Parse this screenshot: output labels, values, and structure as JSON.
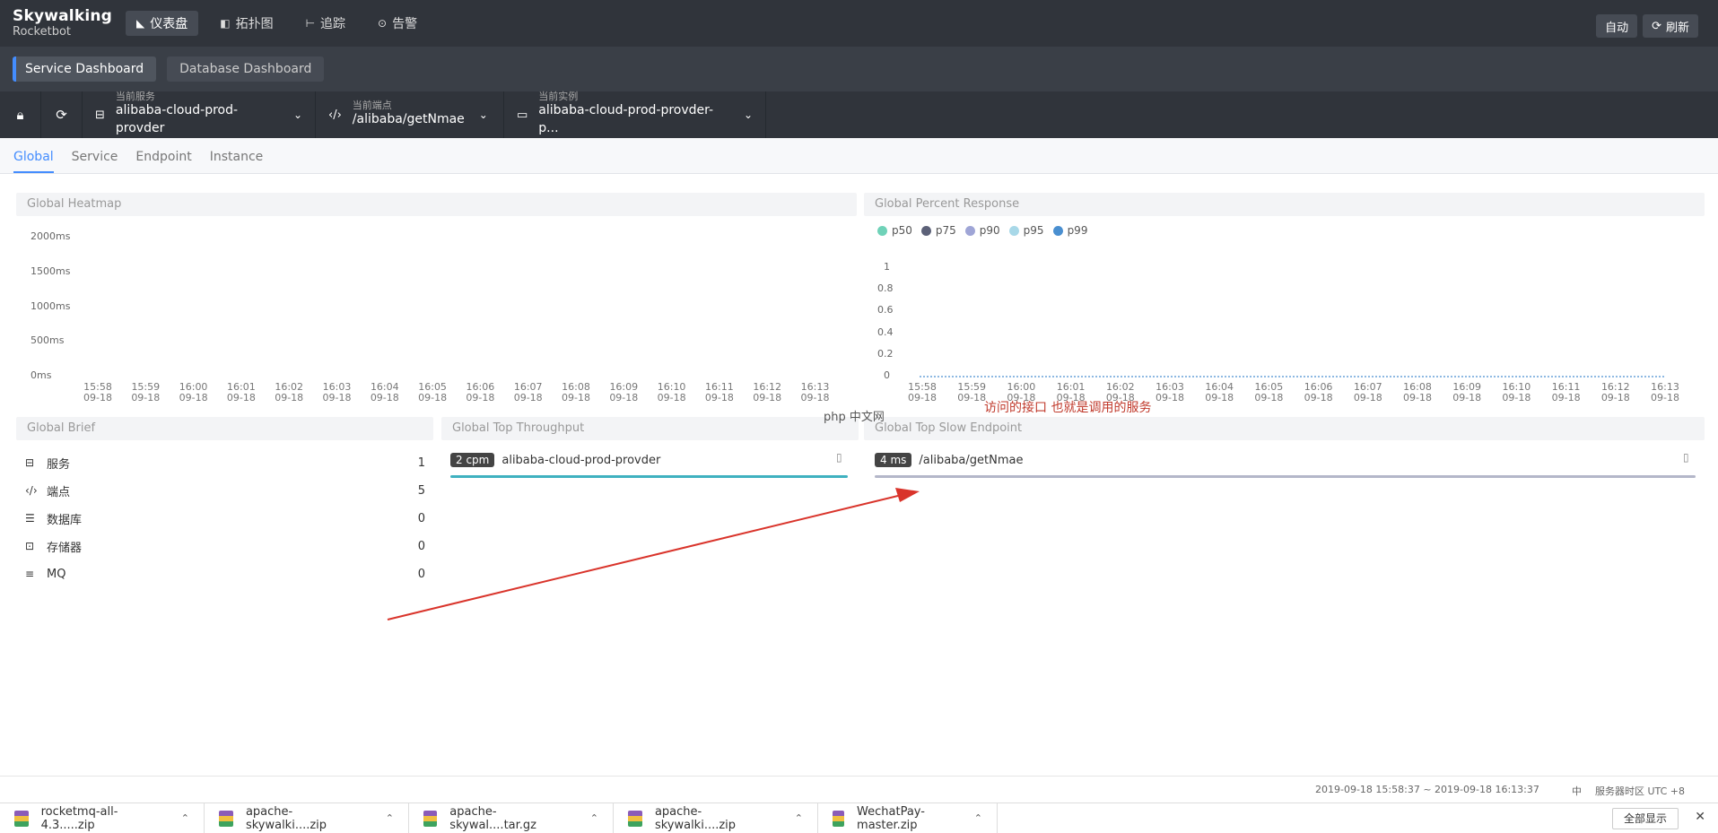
{
  "topbar": {
    "logo_line1": "Skywalking",
    "logo_line2": "Rocketbot",
    "nav": [
      {
        "icon": "dashboard-icon",
        "glyph": "◣",
        "label": "仪表盘",
        "active": true
      },
      {
        "icon": "topology-icon",
        "glyph": "◧",
        "label": "拓扑图",
        "active": false
      },
      {
        "icon": "trace-icon",
        "glyph": "⊢",
        "label": "追踪",
        "active": false
      },
      {
        "icon": "alarm-icon",
        "glyph": "⊙",
        "label": "告警",
        "active": false
      }
    ],
    "auto_label": "自动",
    "refresh_label": "刷新"
  },
  "dashboard_tabs": [
    "Service Dashboard",
    "Database Dashboard"
  ],
  "selectors": {
    "service": {
      "label": "当前服务",
      "value": "alibaba-cloud-prod-provder"
    },
    "endpoint": {
      "label": "当前端点",
      "value": "/alibaba/getNmae"
    },
    "instance": {
      "label": "当前实例",
      "value": "alibaba-cloud-prod-provder-p..."
    }
  },
  "subtabs": [
    "Global",
    "Service",
    "Endpoint",
    "Instance"
  ],
  "heatmap": {
    "title": "Global Heatmap",
    "y_ticks": [
      "2000ms",
      "1500ms",
      "1000ms",
      "500ms",
      "0ms"
    ],
    "x_ticks": [
      "15:58",
      "15:59",
      "16:00",
      "16:01",
      "16:02",
      "16:03",
      "16:04",
      "16:05",
      "16:06",
      "16:07",
      "16:08",
      "16:09",
      "16:10",
      "16:11",
      "16:12",
      "16:13"
    ],
    "date": "09-18"
  },
  "percent": {
    "title": "Global Percent Response",
    "legend": [
      {
        "name": "p50",
        "color": "#6fd2b8"
      },
      {
        "name": "p75",
        "color": "#5c6178"
      },
      {
        "name": "p90",
        "color": "#9fa5d6"
      },
      {
        "name": "p95",
        "color": "#a8d8e8"
      },
      {
        "name": "p99",
        "color": "#4a8fd0"
      }
    ],
    "y_ticks": [
      "1",
      "0.8",
      "0.6",
      "0.4",
      "0.2",
      "0"
    ],
    "x_ticks": [
      "15:58",
      "15:59",
      "16:00",
      "16:01",
      "16:02",
      "16:03",
      "16:04",
      "16:05",
      "16:06",
      "16:07",
      "16:08",
      "16:09",
      "16:10",
      "16:11",
      "16:12",
      "16:13"
    ],
    "date": "09-18"
  },
  "brief": {
    "title": "Global Brief",
    "items": [
      {
        "icon": "service-icon",
        "glyph": "⊟",
        "label": "服务",
        "value": "1"
      },
      {
        "icon": "endpoint-icon",
        "glyph": "‹/›",
        "label": "端点",
        "value": "5"
      },
      {
        "icon": "database-icon",
        "glyph": "☰",
        "label": "数据库",
        "value": "0"
      },
      {
        "icon": "cache-icon",
        "glyph": "⊡",
        "label": "存储器",
        "value": "0"
      },
      {
        "icon": "mq-icon",
        "glyph": "≡",
        "label": "MQ",
        "value": "0"
      }
    ]
  },
  "throughput": {
    "title": "Global Top Throughput",
    "badge": "2 cpm",
    "name": "alibaba-cloud-prod-provder",
    "bar_color": "#3fb1c0"
  },
  "slow": {
    "title": "Global Top Slow Endpoint",
    "badge": "4 ms",
    "name": "/alibaba/getNmae",
    "bar_color": "#b4b7c9"
  },
  "annotation": "访问的接口   也就是调用的服务",
  "watermark": "php 中文网",
  "footer": {
    "range": "2019-09-18 15:58:37 ~ 2019-09-18 16:13:37",
    "lang": "中",
    "tz": "服务器时区 UTC +8"
  },
  "downloads": [
    "rocketmq-all-4.3.....zip",
    "apache-skywalki....zip",
    "apache-skywal....tar.gz",
    "apache-skywalki....zip",
    "WechatPay-master.zip"
  ],
  "show_all": "全部显示"
}
